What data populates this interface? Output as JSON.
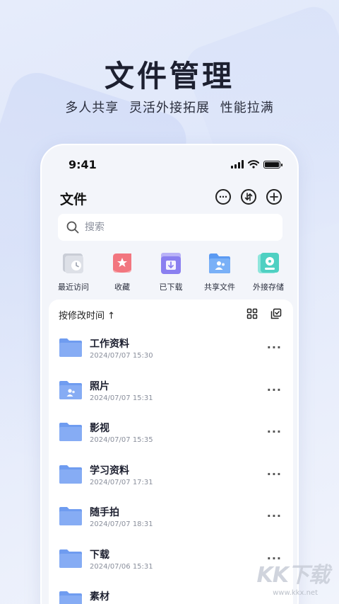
{
  "hero": {
    "title": "文件管理",
    "subtitle": "多人共享 灵活外接拓展 性能拉满"
  },
  "status_bar": {
    "time": "9:41"
  },
  "header": {
    "title": "文件",
    "more_icon": "more-circle-icon",
    "transfer_icon": "transfer-icon",
    "add_icon": "add-circle-icon"
  },
  "search": {
    "placeholder": "搜索"
  },
  "quick_access": [
    {
      "label": "最近访问",
      "icon": "recent-icon"
    },
    {
      "label": "收藏",
      "icon": "favorite-icon"
    },
    {
      "label": "已下载",
      "icon": "downloaded-icon"
    },
    {
      "label": "共享文件",
      "icon": "shared-files-icon"
    },
    {
      "label": "外接存储",
      "icon": "external-storage-icon"
    }
  ],
  "sort": {
    "label": "按修改时间 ↑"
  },
  "files": [
    {
      "name": "工作资料",
      "date": "2024/07/07 15:30",
      "shared": false
    },
    {
      "name": "照片",
      "date": "2024/07/07 15:31",
      "shared": true
    },
    {
      "name": "影视",
      "date": "2024/07/07 15:35",
      "shared": false
    },
    {
      "name": "学习资料",
      "date": "2024/07/07 17:31",
      "shared": false
    },
    {
      "name": "随手拍",
      "date": "2024/07/07 18:31",
      "shared": false
    },
    {
      "name": "下载",
      "date": "2024/07/06 15:31",
      "shared": false
    },
    {
      "name": "素材",
      "date": "",
      "shared": false
    }
  ],
  "watermark": {
    "brand": "KK下载",
    "url": "www.kkx.net"
  },
  "colors": {
    "folder": "#7fa6f2",
    "recent": "#b8bdc8",
    "favorite": "#f2767f",
    "downloaded": "#8a7ff0",
    "shared": "#5b9af2",
    "external": "#4fd0c2"
  }
}
